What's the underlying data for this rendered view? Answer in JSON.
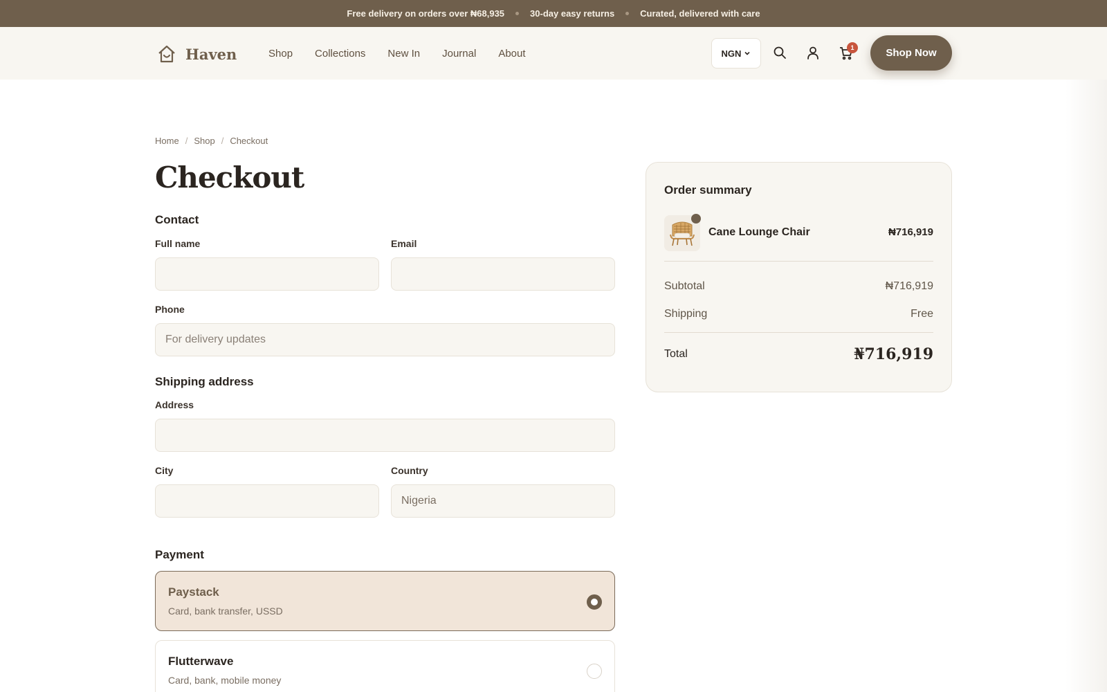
{
  "announcement": {
    "item_1": "Free delivery on orders over ₦68,935",
    "item_2": "30-day easy returns",
    "item_3": "Curated, delivered with care"
  },
  "header": {
    "logo_text": "Haven",
    "nav": [
      "Shop",
      "Collections",
      "New In",
      "Journal",
      "About"
    ],
    "currency": "NGN",
    "cart_count": "1",
    "cta": "Shop Now"
  },
  "breadcrumb": [
    "Home",
    "Shop",
    "Checkout"
  ],
  "page_title": "Checkout",
  "contact": {
    "title": "Contact",
    "full_name_label": "Full name",
    "full_name_value": "",
    "email_label": "Email",
    "email_value": "",
    "phone_label": "Phone",
    "phone_placeholder": "For delivery updates"
  },
  "shipping": {
    "title": "Shipping address",
    "address_label": "Address",
    "city_label": "City",
    "country_label": "Country",
    "country_value": "Nigeria"
  },
  "payment": {
    "title": "Payment",
    "options": [
      {
        "name": "Paystack",
        "desc": "Card, bank transfer, USSD",
        "selected": true
      },
      {
        "name": "Flutterwave",
        "desc": "Card, bank, mobile money",
        "selected": false
      }
    ]
  },
  "summary": {
    "title": "Order summary",
    "item_name": "Cane Lounge Chair",
    "item_price": "₦716,919",
    "subtotal_label": "Subtotal",
    "subtotal_value": "₦716,919",
    "shipping_label": "Shipping",
    "shipping_value": "Free",
    "total_label": "Total",
    "total_value": "₦716,919"
  },
  "colors": {
    "brand": "#6f5f4c",
    "badge": "#c8553d",
    "selected_bg": "#f1e5d9"
  },
  "icons": [
    "home-icon",
    "chevron-down-icon",
    "search-icon",
    "user-icon",
    "cart-icon"
  ]
}
